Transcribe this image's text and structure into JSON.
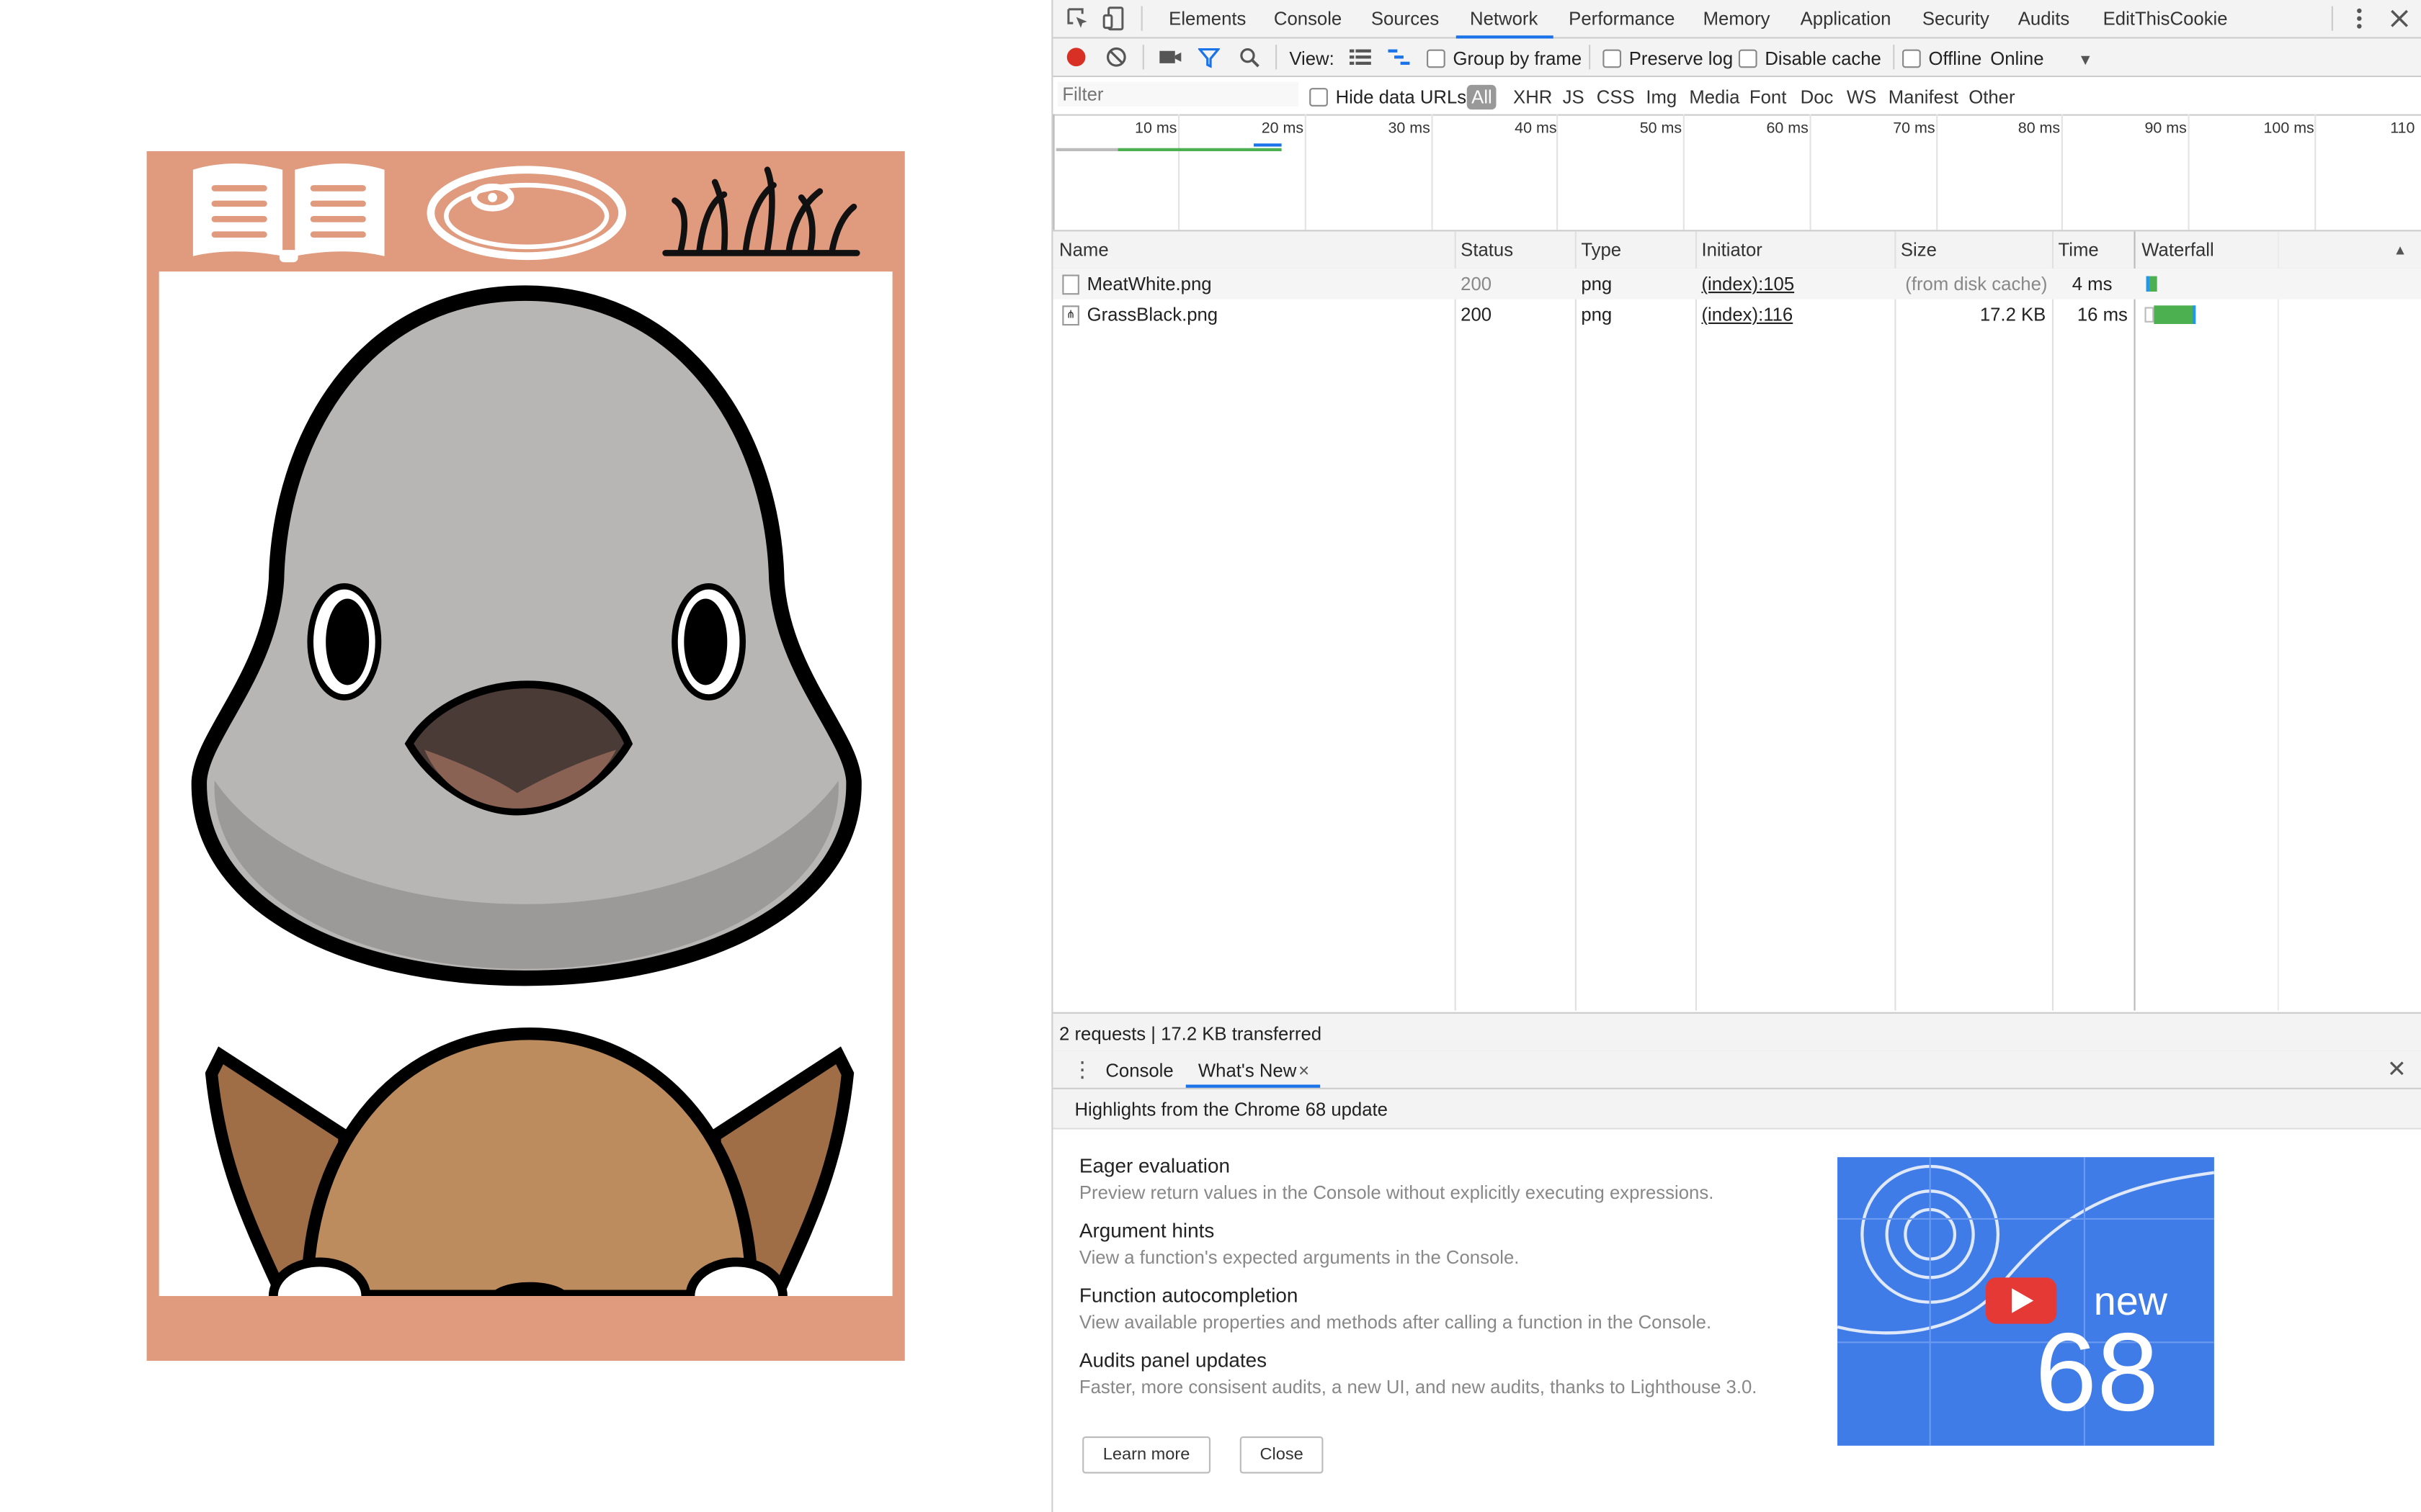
{
  "devtools": {
    "tabs": [
      "Elements",
      "Console",
      "Sources",
      "Network",
      "Performance",
      "Memory",
      "Application",
      "Security",
      "Audits",
      "EditThisCookie"
    ],
    "active_tab": "Network",
    "toolbar": {
      "view_label": "View:",
      "group_by_frame": "Group by frame",
      "preserve_log": "Preserve log",
      "disable_cache": "Disable cache",
      "offline": "Offline",
      "throttle": "Online"
    },
    "filter": {
      "placeholder": "Filter",
      "hide_data_urls": "Hide data URLs",
      "types": [
        "All",
        "XHR",
        "JS",
        "CSS",
        "Img",
        "Media",
        "Font",
        "Doc",
        "WS",
        "Manifest",
        "Other"
      ]
    },
    "overview_ticks": [
      "10 ms",
      "20 ms",
      "30 ms",
      "40 ms",
      "50 ms",
      "60 ms",
      "70 ms",
      "80 ms",
      "90 ms",
      "100 ms",
      "110"
    ],
    "columns": [
      "Name",
      "Status",
      "Type",
      "Initiator",
      "Size",
      "Time",
      "Waterfall"
    ],
    "requests": [
      {
        "name": "MeatWhite.png",
        "status": "200",
        "type": "png",
        "initiator": "(index):105",
        "size": "(from disk cache)",
        "time": "4 ms"
      },
      {
        "name": "GrassBlack.png",
        "status": "200",
        "type": "png",
        "initiator": "(index):116",
        "size": "17.2 KB",
        "time": "16 ms"
      }
    ],
    "summary": "2 requests | 17.2 KB transferred",
    "drawer": {
      "tabs": [
        "Console",
        "What's New"
      ],
      "heading": "Highlights from the Chrome 68 update",
      "features": [
        {
          "title": "Eager evaluation",
          "desc": "Preview return values in the Console without explicitly executing expressions."
        },
        {
          "title": "Argument hints",
          "desc": "View a function's expected arguments in the Console."
        },
        {
          "title": "Function autocompletion",
          "desc": "View available properties and methods after calling a function in the Console."
        },
        {
          "title": "Audits panel updates",
          "desc": "Faster, more consisent audits, a new UI, and new audits, thanks to Lighthouse 3.0."
        }
      ],
      "learn_more": "Learn more",
      "close": "Close",
      "promo_new": "new",
      "promo_version": "68"
    }
  },
  "colors": {
    "card_bg": "#e09a7e",
    "accent_blue": "#1a73e8",
    "record_red": "#d93025",
    "promo_blue": "#3f7ce8"
  }
}
